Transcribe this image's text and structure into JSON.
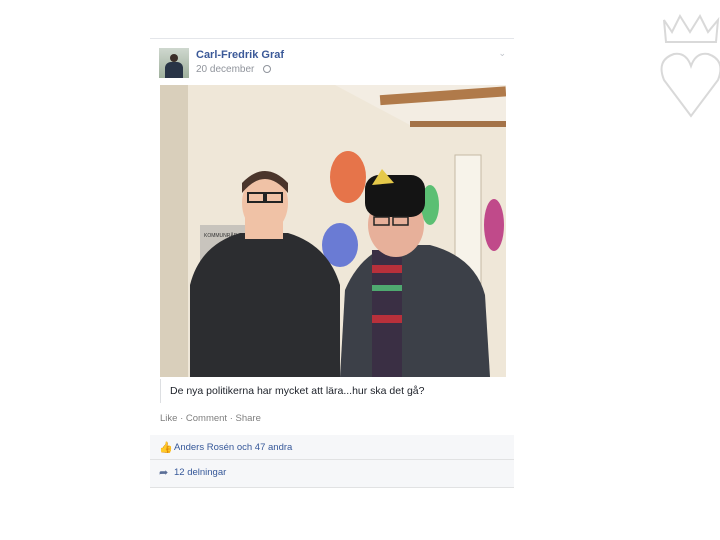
{
  "post": {
    "author": "Carl-Fredrik Graf",
    "date": "20 december",
    "caption": "De nya politikerna har mycket att lära...hur ska det gå?",
    "actions": [
      "Like",
      "Comment",
      "Share"
    ],
    "likes_text": "Anders Rosén och 47 andra",
    "shares_text": "12 delningar",
    "photo_sign": [
      "KOMMUNRÅD"
    ]
  },
  "colors": {
    "link": "#3b5998",
    "meta": "#90949c",
    "background": "#f6f7f9"
  },
  "icons": [
    "globe-icon",
    "chevron-down-icon",
    "thumbs-up-icon",
    "share-icon",
    "crown-heart-logo"
  ]
}
